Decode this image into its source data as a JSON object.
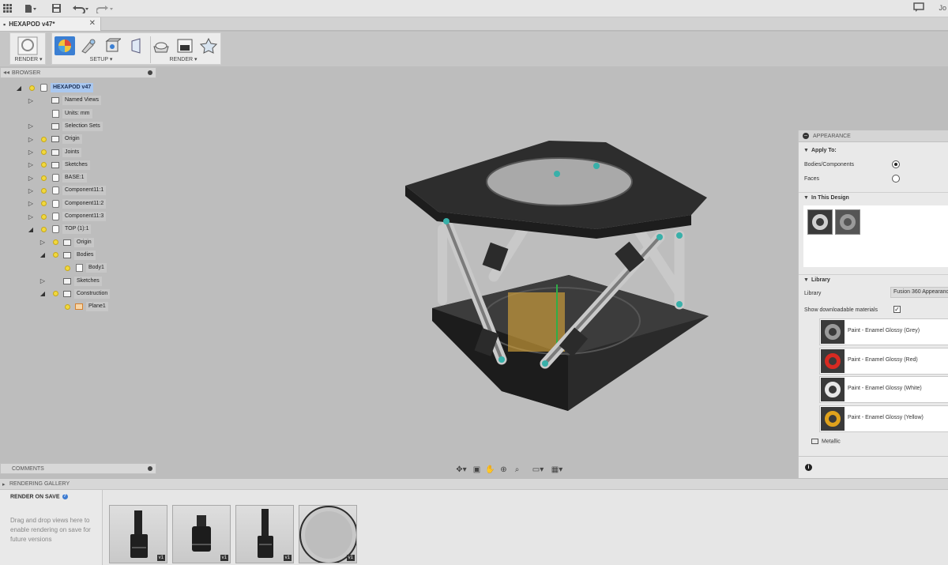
{
  "app": {
    "user_short": "Jo",
    "document_tab": "HEXAPOD v47*"
  },
  "toolbar": {
    "render_label": "RENDER ▾",
    "setup_label": "SETUP ▾",
    "render2_label": "RENDER ▾"
  },
  "browser": {
    "title": "BROWSER",
    "items": [
      {
        "label": "HEXAPOD v47",
        "indent": 0,
        "expander": "down",
        "kind": "comp",
        "bulb": true,
        "selected": true
      },
      {
        "label": "Named Views",
        "indent": 1,
        "expander": "right",
        "kind": "folder",
        "bulb": false
      },
      {
        "label": "Units: mm",
        "indent": 1,
        "expander": "none",
        "kind": "doc",
        "bulb": false
      },
      {
        "label": "Selection Sets",
        "indent": 1,
        "expander": "right",
        "kind": "folder",
        "bulb": false
      },
      {
        "label": "Origin",
        "indent": 1,
        "expander": "right",
        "kind": "folder",
        "bulb": true
      },
      {
        "label": "Joints",
        "indent": 1,
        "expander": "right",
        "kind": "folder",
        "bulb": true
      },
      {
        "label": "Sketches",
        "indent": 1,
        "expander": "right",
        "kind": "folder",
        "bulb": true
      },
      {
        "label": "BASE:1",
        "indent": 1,
        "expander": "right",
        "kind": "comp",
        "bulb": true
      },
      {
        "label": "Component11:1",
        "indent": 1,
        "expander": "right",
        "kind": "comp",
        "bulb": true
      },
      {
        "label": "Component11:2",
        "indent": 1,
        "expander": "right",
        "kind": "comp",
        "bulb": true
      },
      {
        "label": "Component11:3",
        "indent": 1,
        "expander": "right",
        "kind": "comp",
        "bulb": true
      },
      {
        "label": "TOP (1):1",
        "indent": 1,
        "expander": "down",
        "kind": "comp",
        "bulb": true
      },
      {
        "label": "Origin",
        "indent": 2,
        "expander": "right",
        "kind": "folder",
        "bulb": true
      },
      {
        "label": "Bodies",
        "indent": 2,
        "expander": "down",
        "kind": "folder",
        "bulb": true
      },
      {
        "label": "Body1",
        "indent": 3,
        "expander": "none",
        "kind": "body",
        "bulb": true
      },
      {
        "label": "Sketches",
        "indent": 2,
        "expander": "right",
        "kind": "folder",
        "bulb": false
      },
      {
        "label": "Construction",
        "indent": 2,
        "expander": "down",
        "kind": "folder",
        "bulb": true
      },
      {
        "label": "Plane1",
        "indent": 3,
        "expander": "none",
        "kind": "plane",
        "bulb": true
      }
    ]
  },
  "comments": {
    "title": "COMMENTS"
  },
  "appearance": {
    "title": "APPEARANCE",
    "apply_to_heading": "Apply To:",
    "options": [
      {
        "label": "Bodies/Components",
        "checked": true
      },
      {
        "label": "Faces",
        "checked": false
      }
    ],
    "in_this_design_heading": "In This Design",
    "library_heading": "Library",
    "library_label": "Library",
    "library_value": "Fusion 360 Appearance",
    "show_downloadable_label": "Show downloadable materials",
    "show_downloadable_checked": true,
    "materials": [
      {
        "name": "Paint - Enamel Glossy (Grey)",
        "color": "#9a9a9a"
      },
      {
        "name": "Paint - Enamel Glossy (Red)",
        "color": "#d62a22"
      },
      {
        "name": "Paint - Enamel Glossy (White)",
        "color": "#e8e8e8"
      },
      {
        "name": "Paint - Enamel Glossy (Yellow)",
        "color": "#e0a21c"
      }
    ],
    "metallic_label": "Metallic"
  },
  "gallery": {
    "title": "RENDERING GALLERY",
    "render_on_save": "RENDER ON SAVE",
    "hint": "Drag and drop views here to enable rendering on save for future versions",
    "thumbnails": [
      {
        "version": "v1"
      },
      {
        "version": "v1"
      },
      {
        "version": "v1"
      },
      {
        "version": "v1"
      }
    ]
  }
}
